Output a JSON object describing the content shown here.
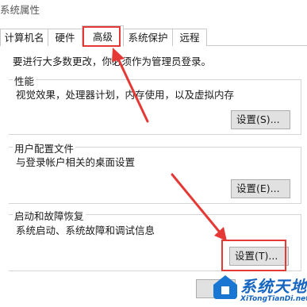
{
  "window": {
    "title": "系统属性"
  },
  "tabs": [
    {
      "label": "计算机名"
    },
    {
      "label": "硬件"
    },
    {
      "label": "高级"
    },
    {
      "label": "系统保护"
    },
    {
      "label": "远程"
    }
  ],
  "active_tab": "高级",
  "notice": "要进行大多数更改，你必须作为管理员登录。",
  "groups": {
    "performance": {
      "label": "性能",
      "description": "视觉效果，处理器计划，内存使用，以及虚拟内存",
      "button": "设置(S)..."
    },
    "user_profiles": {
      "label": "用户配置文件",
      "description": "与登录帐户相关的桌面设置",
      "button": "设置(E)..."
    },
    "startup_recovery": {
      "label": "启动和故障恢复",
      "description": "系统启动、系统故障和调试信息",
      "button": "设置(T)..."
    }
  },
  "annotations": {
    "highlight_color": "#e53935"
  },
  "watermark": {
    "brand": "系统天地",
    "url": "XiTongTianDi.net",
    "color": "#1565c0"
  }
}
